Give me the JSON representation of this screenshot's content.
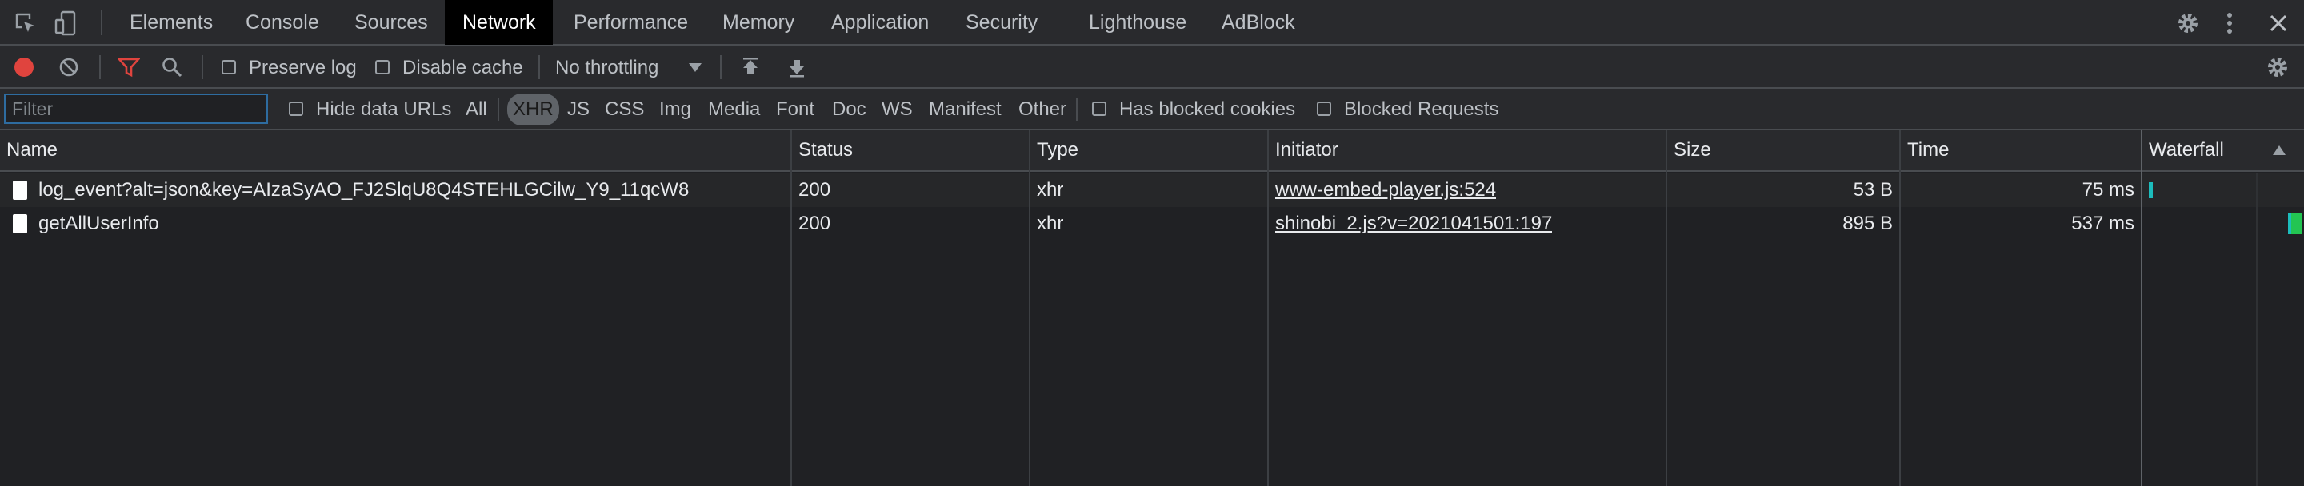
{
  "tabs": [
    {
      "label": "Elements"
    },
    {
      "label": "Console"
    },
    {
      "label": "Sources"
    },
    {
      "label": "Network"
    },
    {
      "label": "Performance"
    },
    {
      "label": "Memory"
    },
    {
      "label": "Application"
    },
    {
      "label": "Security"
    },
    {
      "label": "Lighthouse"
    },
    {
      "label": "AdBlock"
    }
  ],
  "active_tab": "Network",
  "toolbar": {
    "preserve_log": "Preserve log",
    "disable_cache": "Disable cache",
    "throttling": "No throttling"
  },
  "filterbar": {
    "filter_placeholder": "Filter",
    "hide_data_urls": "Hide data URLs",
    "types": [
      "All",
      "XHR",
      "JS",
      "CSS",
      "Img",
      "Media",
      "Font",
      "Doc",
      "WS",
      "Manifest",
      "Other"
    ],
    "active_type": "XHR",
    "has_blocked_cookies": "Has blocked cookies",
    "blocked_requests": "Blocked Requests"
  },
  "columns": {
    "name": "Name",
    "status": "Status",
    "type": "Type",
    "initiator": "Initiator",
    "size": "Size",
    "time": "Time",
    "waterfall": "Waterfall"
  },
  "rows": [
    {
      "name": "log_event?alt=json&key=AIzaSyAO_FJ2SlqU8Q4STEHLGCilw_Y9_11qcW8",
      "status": "200",
      "type": "xhr",
      "initiator": "www-embed-player.js:524",
      "size": "53 B",
      "time": "75 ms"
    },
    {
      "name": "getAllUserInfo",
      "status": "200",
      "type": "xhr",
      "initiator": "shinobi_2.js?v=2021041501:197",
      "size": "895 B",
      "time": "537 ms"
    }
  ],
  "colors": {
    "record": "#e0443e",
    "filter_active": "#e0443e",
    "waterfall_bar": "#1cbcbc",
    "waterfall_bar2": "#23c552"
  }
}
